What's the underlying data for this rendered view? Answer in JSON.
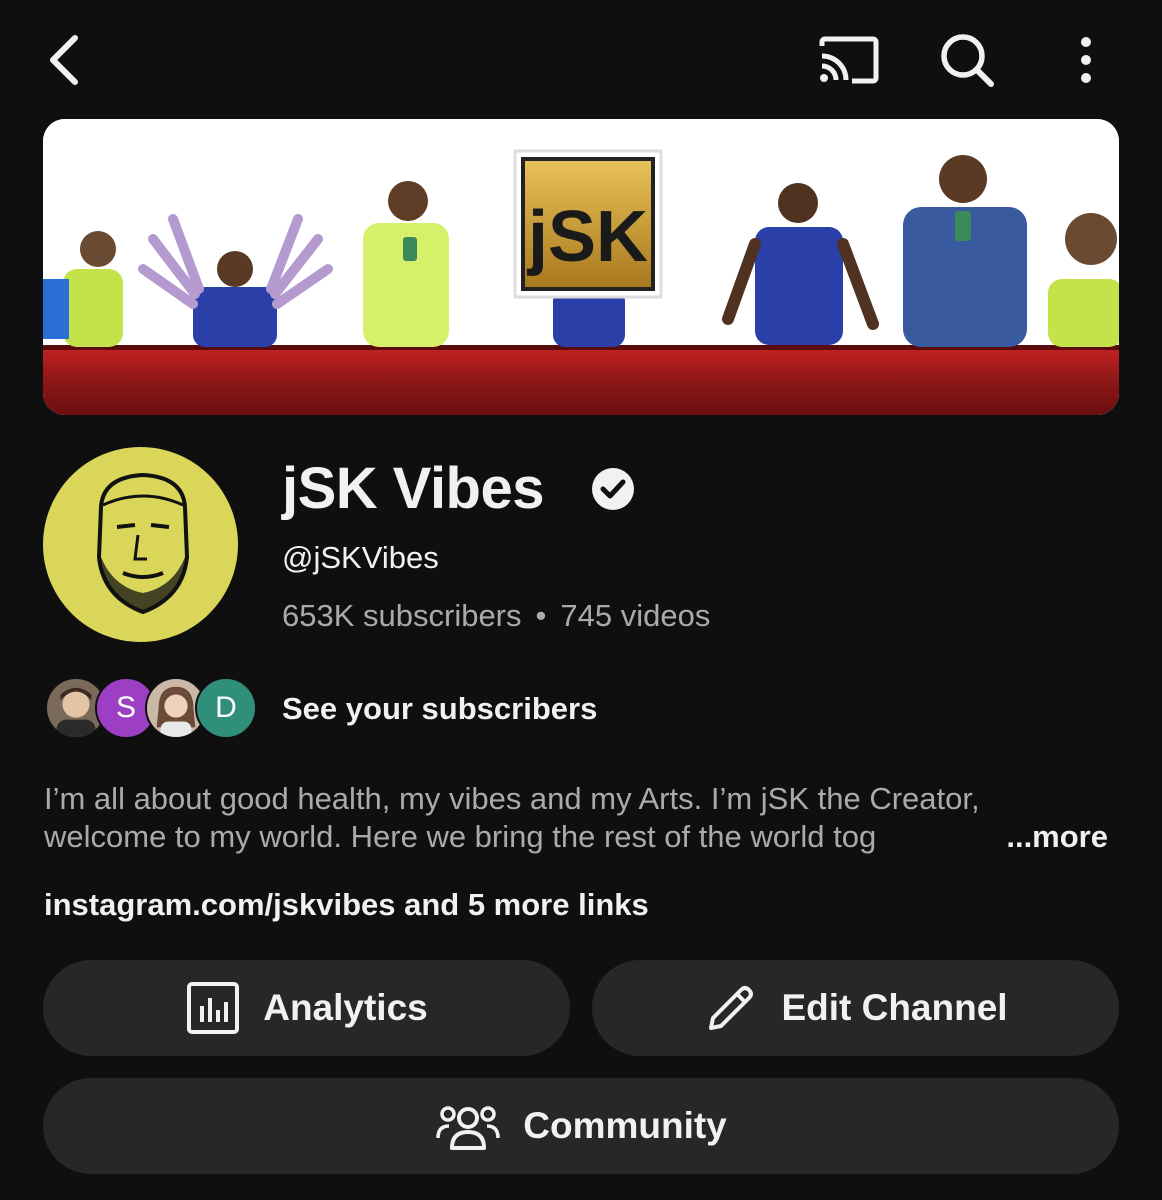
{
  "topbar": {
    "back_icon": "chevron-left-icon",
    "cast_icon": "cast-icon",
    "search_icon": "search-icon",
    "more_icon": "more-vertical-icon"
  },
  "banner": {
    "logo_text": "jSK",
    "accent_red": "#a11a1a"
  },
  "channel": {
    "name": "jSK Vibes",
    "handle": "@jSKVibes",
    "subscribers": "653K subscribers",
    "separator": "•",
    "videos": "745 videos",
    "avatar_bg": "#d9d65a"
  },
  "subscribers_preview": {
    "label": "See your subscribers",
    "avatars": [
      {
        "letter": "",
        "color": "#7a6a5a"
      },
      {
        "letter": "S",
        "color": "#9c3fc4"
      },
      {
        "letter": "",
        "color": "#c9b8a8"
      },
      {
        "letter": "D",
        "color": "#2f8f7a"
      }
    ]
  },
  "description": {
    "line1": "I’m all about good health, my vibes and my Arts. I’m jSK the Creator,",
    "line2": "welcome to my world. Here we bring the rest of the world tog",
    "more": "...more"
  },
  "links": {
    "text": "instagram.com/jskvibes and 5 more links"
  },
  "actions": {
    "analytics_label": "Analytics",
    "edit_label": "Edit Channel",
    "community_label": "Community"
  }
}
